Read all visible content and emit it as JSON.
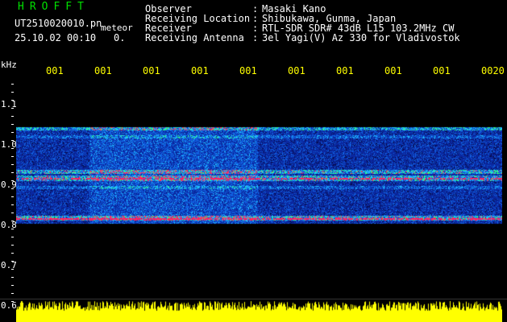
{
  "header": {
    "brand": "HROFFT",
    "file_name": "UT2510020010.pn",
    "file_tag": "meteor",
    "timestamp": "25.10.02 00:10",
    "count": "0.",
    "info": [
      {
        "label": "Observer",
        "value": "Masaki Kano"
      },
      {
        "label": "Receiving Location",
        "value": "Shibukawa, Gunma, Japan"
      },
      {
        "label": "Receiver",
        "value": "RTL-SDR SDR# 43dB L15 103.2MHz CW"
      },
      {
        "label": "Receiving Antenna",
        "value": "3el Yagi(V) Az 330 for Vladivostok"
      }
    ]
  },
  "axis": {
    "unit": "kHz",
    "y_ticks": [
      "1.1",
      "1.0",
      "0.9",
      "0.8",
      "0.7",
      "0.6"
    ],
    "x_ticks": [
      "001",
      "001",
      "001",
      "001",
      "001",
      "001",
      "001",
      "001",
      "001",
      "0020"
    ]
  },
  "colors": {
    "background": "#000000",
    "label": "#ffffff",
    "brand": "#00e000",
    "time_axis": "#ffff00",
    "amplitude": "#ffff00"
  }
}
